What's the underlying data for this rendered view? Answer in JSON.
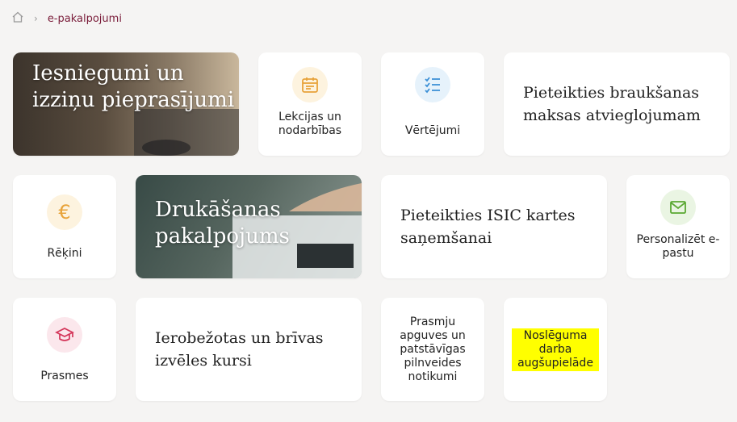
{
  "breadcrumb": {
    "home_icon": "home-icon",
    "separator_icon": "chevron-right-icon",
    "current": "e-pakalpojumi"
  },
  "tiles": {
    "iesniegumi": {
      "title": "Iesniegumi un izziņu pieprasījumi"
    },
    "lekcijas": {
      "label": "Lekcijas un nodarbības",
      "icon": "calendar-icon",
      "color": "#e8a33a"
    },
    "vertejumi": {
      "label": "Vērtējumi",
      "icon": "checklist-icon",
      "color": "#3a8fd6"
    },
    "braukšana": {
      "label": "Pieteikties braukšanas maksas atvieglojumam"
    },
    "rekini": {
      "label": "Rēķini",
      "icon": "euro-icon",
      "color": "#e8a33a"
    },
    "drukasana": {
      "title": "Drukāšanas pakalpojums"
    },
    "isic": {
      "label": "Pieteikties ISIC kartes saņemšanai"
    },
    "epasts": {
      "label": "Personalizēt e-pastu",
      "icon": "mail-icon",
      "color": "#5aa832"
    },
    "prasmes": {
      "label": "Prasmes",
      "icon": "graduation-cap-icon",
      "color": "#d4365a"
    },
    "kursi": {
      "label": "Ierobežotas un brīvas izvēles kursi"
    },
    "pasakumi": {
      "label": "Prasmju apguves un patstāvīgas pilnveides notikumi"
    },
    "nosleguma": {
      "label": "Noslēguma darba augšupielāde"
    }
  }
}
